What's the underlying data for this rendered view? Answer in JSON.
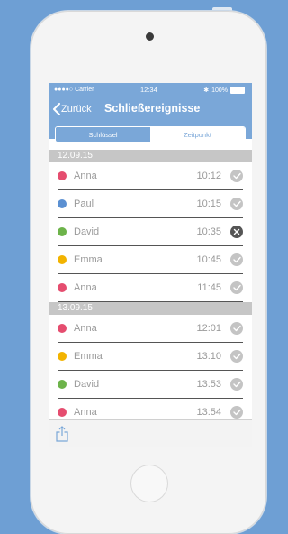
{
  "statusbar": {
    "carrier": "●●●●○ Carrier",
    "time": "12:34",
    "battery": "100%"
  },
  "nav": {
    "back_label": "Zurück",
    "title": "Schließereignisse"
  },
  "segments": [
    {
      "label": "Schlüssel",
      "selected": false
    },
    {
      "label": "Zeitpunkt",
      "selected": true
    }
  ],
  "colors": {
    "accent": "#7aa7d8",
    "status_ok": "#c4c4c4",
    "status_denied": "#555555",
    "red": "#e54d6f",
    "blue": "#5b90d2",
    "green": "#6db34a",
    "yellow": "#f2b300"
  },
  "sections": [
    {
      "date": "12.09.15",
      "events": [
        {
          "name": "Anna",
          "time": "10:12",
          "color": "#e54d6f",
          "status": "ok"
        },
        {
          "name": "Paul",
          "time": "10:15",
          "color": "#5b90d2",
          "status": "ok"
        },
        {
          "name": "David",
          "time": "10:35",
          "color": "#6db34a",
          "status": "denied"
        },
        {
          "name": "Emma",
          "time": "10:45",
          "color": "#f2b300",
          "status": "ok"
        },
        {
          "name": "Anna",
          "time": "11:45",
          "color": "#e54d6f",
          "status": "ok"
        }
      ]
    },
    {
      "date": "13.09.15",
      "events": [
        {
          "name": "Anna",
          "time": "12:01",
          "color": "#e54d6f",
          "status": "ok"
        },
        {
          "name": "Emma",
          "time": "13:10",
          "color": "#f2b300",
          "status": "ok"
        },
        {
          "name": "David",
          "time": "13:53",
          "color": "#6db34a",
          "status": "ok"
        },
        {
          "name": "Anna",
          "time": "13:54",
          "color": "#e54d6f",
          "status": "ok"
        }
      ]
    }
  ],
  "toolbar": {
    "share_icon": "share-icon"
  }
}
